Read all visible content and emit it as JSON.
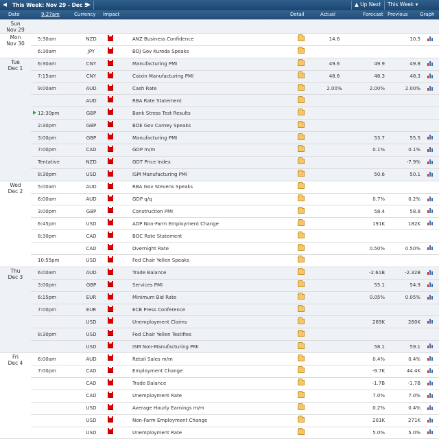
{
  "toolbar": {
    "prev_arrow": "◀",
    "title": "This Week: Nov 29 - Dec 5",
    "next_arrow": "▶",
    "up_next": "Up Next",
    "up_next_arrow": "▲",
    "this_week": "This Week",
    "this_week_chevron": "▾"
  },
  "columns": {
    "date": "Date",
    "time": "9:27am",
    "currency": "Currency",
    "impact": "Impact",
    "detail": "Detail",
    "actual": "Actual",
    "forecast": "Forecast",
    "previous": "Previous",
    "graph": "Graph"
  },
  "days": [
    {
      "label": [
        "Sun",
        "Nov 29"
      ],
      "rows": [
        {
          "time": "",
          "currency": "",
          "event": "",
          "actual": "",
          "forecast": "",
          "previous": "",
          "impact": false,
          "detail": false,
          "graph": false
        }
      ]
    },
    {
      "label": [
        "Mon",
        "Nov 30"
      ],
      "rows": [
        {
          "time": "5:30am",
          "currency": "NZD",
          "event": "ANZ Business Confidence",
          "actual": "14.6",
          "forecast": "",
          "previous": "10.5",
          "impact": true,
          "detail": true,
          "graph": true
        },
        {
          "time": "6:30am",
          "currency": "JPY",
          "event": "BOJ Gov Kuroda Speaks",
          "actual": "",
          "forecast": "",
          "previous": "",
          "impact": true,
          "detail": true,
          "graph": false
        }
      ]
    },
    {
      "label": [
        "Tue",
        "Dec 1"
      ],
      "rows": [
        {
          "time": "6:30am",
          "currency": "CNY",
          "event": "Manufacturing PMI",
          "actual": "49.6",
          "forecast": "49.9",
          "previous": "49.8",
          "impact": true,
          "detail": true,
          "graph": true
        },
        {
          "time": "7:15am",
          "currency": "CNY",
          "event": "Caixin Manufacturing PMI",
          "actual": "48.6",
          "forecast": "48.3",
          "previous": "48.3",
          "impact": true,
          "detail": true,
          "graph": true
        },
        {
          "time": "9:00am",
          "currency": "AUD",
          "event": "Cash Rate",
          "actual": "2.00%",
          "forecast": "2.00%",
          "previous": "2.00%",
          "impact": true,
          "detail": true,
          "graph": true
        },
        {
          "time": "",
          "currency": "AUD",
          "event": "RBA Rate Statement",
          "actual": "",
          "forecast": "",
          "previous": "",
          "impact": true,
          "detail": true,
          "graph": false
        },
        {
          "time": "12:30pm",
          "currency": "GBP",
          "event": "Bank Stress Test Results",
          "actual": "",
          "forecast": "",
          "previous": "",
          "impact": true,
          "detail": true,
          "graph": false,
          "play": true
        },
        {
          "time": "2:30pm",
          "currency": "GBP",
          "event": "BOE Gov Carney Speaks",
          "actual": "",
          "forecast": "",
          "previous": "",
          "impact": true,
          "detail": true,
          "graph": false
        },
        {
          "time": "3:00pm",
          "currency": "GBP",
          "event": "Manufacturing PMI",
          "actual": "",
          "forecast": "53.7",
          "previous": "55.5",
          "impact": true,
          "detail": true,
          "graph": true
        },
        {
          "time": "7:00pm",
          "currency": "CAD",
          "event": "GDP m/m",
          "actual": "",
          "forecast": "0.1%",
          "previous": "0.1%",
          "impact": true,
          "detail": true,
          "graph": true
        },
        {
          "time": "Tentative",
          "currency": "NZD",
          "event": "GDT Price Index",
          "actual": "",
          "forecast": "",
          "previous": "-7.9%",
          "impact": true,
          "detail": true,
          "graph": true
        },
        {
          "time": "8:30pm",
          "currency": "USD",
          "event": "ISM Manufacturing PMI",
          "actual": "",
          "forecast": "50.6",
          "previous": "50.1",
          "impact": true,
          "detail": true,
          "graph": true
        }
      ]
    },
    {
      "label": [
        "Wed",
        "Dec 2"
      ],
      "rows": [
        {
          "time": "5:00am",
          "currency": "AUD",
          "event": "RBA Gov Stevens Speaks",
          "actual": "",
          "forecast": "",
          "previous": "",
          "impact": true,
          "detail": true,
          "graph": false
        },
        {
          "time": "6:00am",
          "currency": "AUD",
          "event": "GDP q/q",
          "actual": "",
          "forecast": "0.7%",
          "previous": "0.2%",
          "impact": true,
          "detail": true,
          "graph": true
        },
        {
          "time": "3:00pm",
          "currency": "GBP",
          "event": "Construction PMI",
          "actual": "",
          "forecast": "58.4",
          "previous": "58.8",
          "impact": true,
          "detail": true,
          "graph": true
        },
        {
          "time": "6:45pm",
          "currency": "USD",
          "event": "ADP Non-Farm Employment Change",
          "actual": "",
          "forecast": "191K",
          "previous": "182K",
          "impact": true,
          "detail": true,
          "graph": true
        },
        {
          "time": "8:30pm",
          "currency": "CAD",
          "event": "BOC Rate Statement",
          "actual": "",
          "forecast": "",
          "previous": "",
          "impact": true,
          "detail": true,
          "graph": false
        },
        {
          "time": "",
          "currency": "CAD",
          "event": "Overnight Rate",
          "actual": "",
          "forecast": "0.50%",
          "previous": "0.50%",
          "impact": true,
          "detail": true,
          "graph": true
        },
        {
          "time": "10:55pm",
          "currency": "USD",
          "event": "Fed Chair Yellen Speaks",
          "actual": "",
          "forecast": "",
          "previous": "",
          "impact": true,
          "detail": true,
          "graph": false
        }
      ]
    },
    {
      "label": [
        "Thu",
        "Dec 3"
      ],
      "rows": [
        {
          "time": "6:00am",
          "currency": "AUD",
          "event": "Trade Balance",
          "actual": "",
          "forecast": "-2.61B",
          "previous": "-2.32B",
          "impact": true,
          "detail": true,
          "graph": true
        },
        {
          "time": "3:00pm",
          "currency": "GBP",
          "event": "Services PMI",
          "actual": "",
          "forecast": "55.1",
          "previous": "54.9",
          "impact": true,
          "detail": true,
          "graph": true
        },
        {
          "time": "6:15pm",
          "currency": "EUR",
          "event": "Minimum Bid Rate",
          "actual": "",
          "forecast": "0.05%",
          "previous": "0.05%",
          "impact": true,
          "detail": true,
          "graph": true
        },
        {
          "time": "7:00pm",
          "currency": "EUR",
          "event": "ECB Press Conference",
          "actual": "",
          "forecast": "",
          "previous": "",
          "impact": true,
          "detail": true,
          "graph": false
        },
        {
          "time": "",
          "currency": "USD",
          "event": "Unemployment Claims",
          "actual": "",
          "forecast": "269K",
          "previous": "260K",
          "impact": true,
          "detail": true,
          "graph": true
        },
        {
          "time": "8:30pm",
          "currency": "USD",
          "event": "Fed Chair Yellen Testifies",
          "actual": "",
          "forecast": "",
          "previous": "",
          "impact": true,
          "detail": true,
          "graph": false
        },
        {
          "time": "",
          "currency": "USD",
          "event": "ISM Non-Manufacturing PMI",
          "actual": "",
          "forecast": "58.1",
          "previous": "59.1",
          "impact": true,
          "detail": true,
          "graph": true
        }
      ]
    },
    {
      "label": [
        "Fri",
        "Dec 4"
      ],
      "rows": [
        {
          "time": "6:00am",
          "currency": "AUD",
          "event": "Retail Sales m/m",
          "actual": "",
          "forecast": "0.4%",
          "previous": "0.4%",
          "impact": true,
          "detail": true,
          "graph": true
        },
        {
          "time": "7:00pm",
          "currency": "CAD",
          "event": "Employment Change",
          "actual": "",
          "forecast": "-9.7K",
          "previous": "44.4K",
          "impact": true,
          "detail": true,
          "graph": true
        },
        {
          "time": "",
          "currency": "CAD",
          "event": "Trade Balance",
          "actual": "",
          "forecast": "-1.7B",
          "previous": "-1.7B",
          "impact": true,
          "detail": true,
          "graph": true
        },
        {
          "time": "",
          "currency": "CAD",
          "event": "Unemployment Rate",
          "actual": "",
          "forecast": "7.0%",
          "previous": "7.0%",
          "impact": true,
          "detail": true,
          "graph": true
        },
        {
          "time": "",
          "currency": "USD",
          "event": "Average Hourly Earnings m/m",
          "actual": "",
          "forecast": "0.2%",
          "previous": "0.4%",
          "impact": true,
          "detail": true,
          "graph": true
        },
        {
          "time": "",
          "currency": "USD",
          "event": "Non-Farm Employment Change",
          "actual": "",
          "forecast": "201K",
          "previous": "271K",
          "impact": true,
          "detail": true,
          "graph": true
        },
        {
          "time": "",
          "currency": "USD",
          "event": "Unemployment Rate",
          "actual": "",
          "forecast": "5.0%",
          "previous": "5.0%",
          "impact": true,
          "detail": true,
          "graph": true
        }
      ]
    }
  ],
  "icons": {
    "impact": "high-impact-folder-icon",
    "detail": "detail-folder-icon",
    "graph": "bar-graph-icon",
    "play": "play-icon"
  },
  "colors": {
    "header_bg": "#1c4670",
    "impact_red": "#d60000",
    "shade_bg": "#eef1f5"
  }
}
